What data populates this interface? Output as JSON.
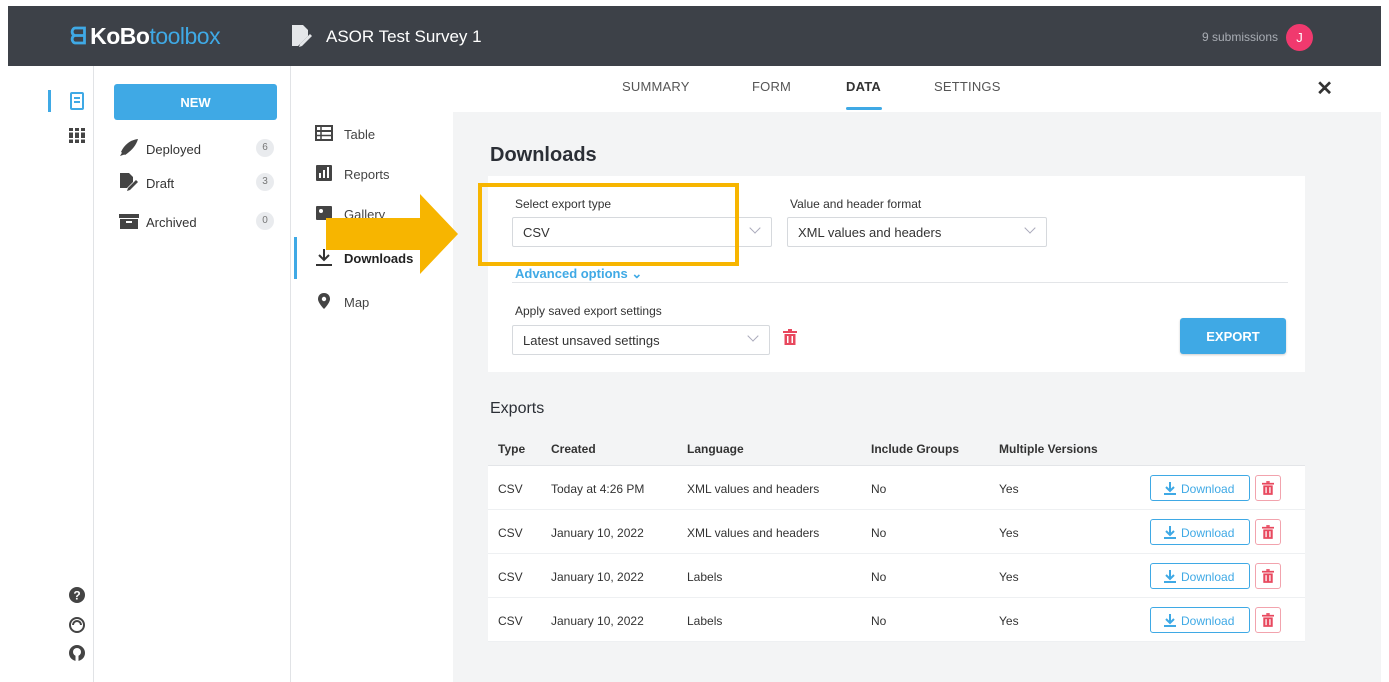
{
  "header": {
    "logo_prefix": "KoBo",
    "logo_suffix": "toolbox",
    "survey_title": "ASOR Test Survey 1",
    "submissions": "9 submissions",
    "avatar_initial": "J"
  },
  "sidebar": {
    "new_label": "NEW",
    "items": [
      {
        "label": "Deployed",
        "count": "6"
      },
      {
        "label": "Draft",
        "count": "3"
      },
      {
        "label": "Archived",
        "count": "0"
      }
    ]
  },
  "tabs": [
    {
      "label": "SUMMARY"
    },
    {
      "label": "FORM"
    },
    {
      "label": "DATA",
      "active": true
    },
    {
      "label": "SETTINGS"
    }
  ],
  "close_label": "✕",
  "subnav": [
    {
      "label": "Table",
      "icon": "table-icon"
    },
    {
      "label": "Reports",
      "icon": "reports-icon"
    },
    {
      "label": "Gallery",
      "icon": "gallery-icon"
    },
    {
      "label": "Downloads",
      "icon": "download-icon",
      "active": true
    },
    {
      "label": "Map",
      "icon": "map-pin-icon"
    }
  ],
  "downloads": {
    "title": "Downloads",
    "export_type_label": "Select export type",
    "export_type_value": "CSV",
    "format_label": "Value and header format",
    "format_value": "XML values and headers",
    "advanced_label": "Advanced options",
    "saved_settings_label": "Apply saved export settings",
    "saved_settings_value": "Latest unsaved settings",
    "export_button": "EXPORT"
  },
  "exports": {
    "title": "Exports",
    "columns": [
      "Type",
      "Created",
      "Language",
      "Include Groups",
      "Multiple Versions"
    ],
    "rows": [
      [
        "CSV",
        "Today at 4:26 PM",
        "XML values and headers",
        "No",
        "Yes"
      ],
      [
        "CSV",
        "January 10, 2022",
        "XML values and headers",
        "No",
        "Yes"
      ],
      [
        "CSV",
        "January 10, 2022",
        "Labels",
        "No",
        "Yes"
      ],
      [
        "CSV",
        "January 10, 2022",
        "Labels",
        "No",
        "Yes"
      ]
    ],
    "download_label": "Download"
  },
  "colors": {
    "accent": "#3fa9e5",
    "topbar": "#3d4148",
    "avatar": "#f0396e",
    "delete": "#e8485e",
    "highlight": "#f7b500"
  }
}
